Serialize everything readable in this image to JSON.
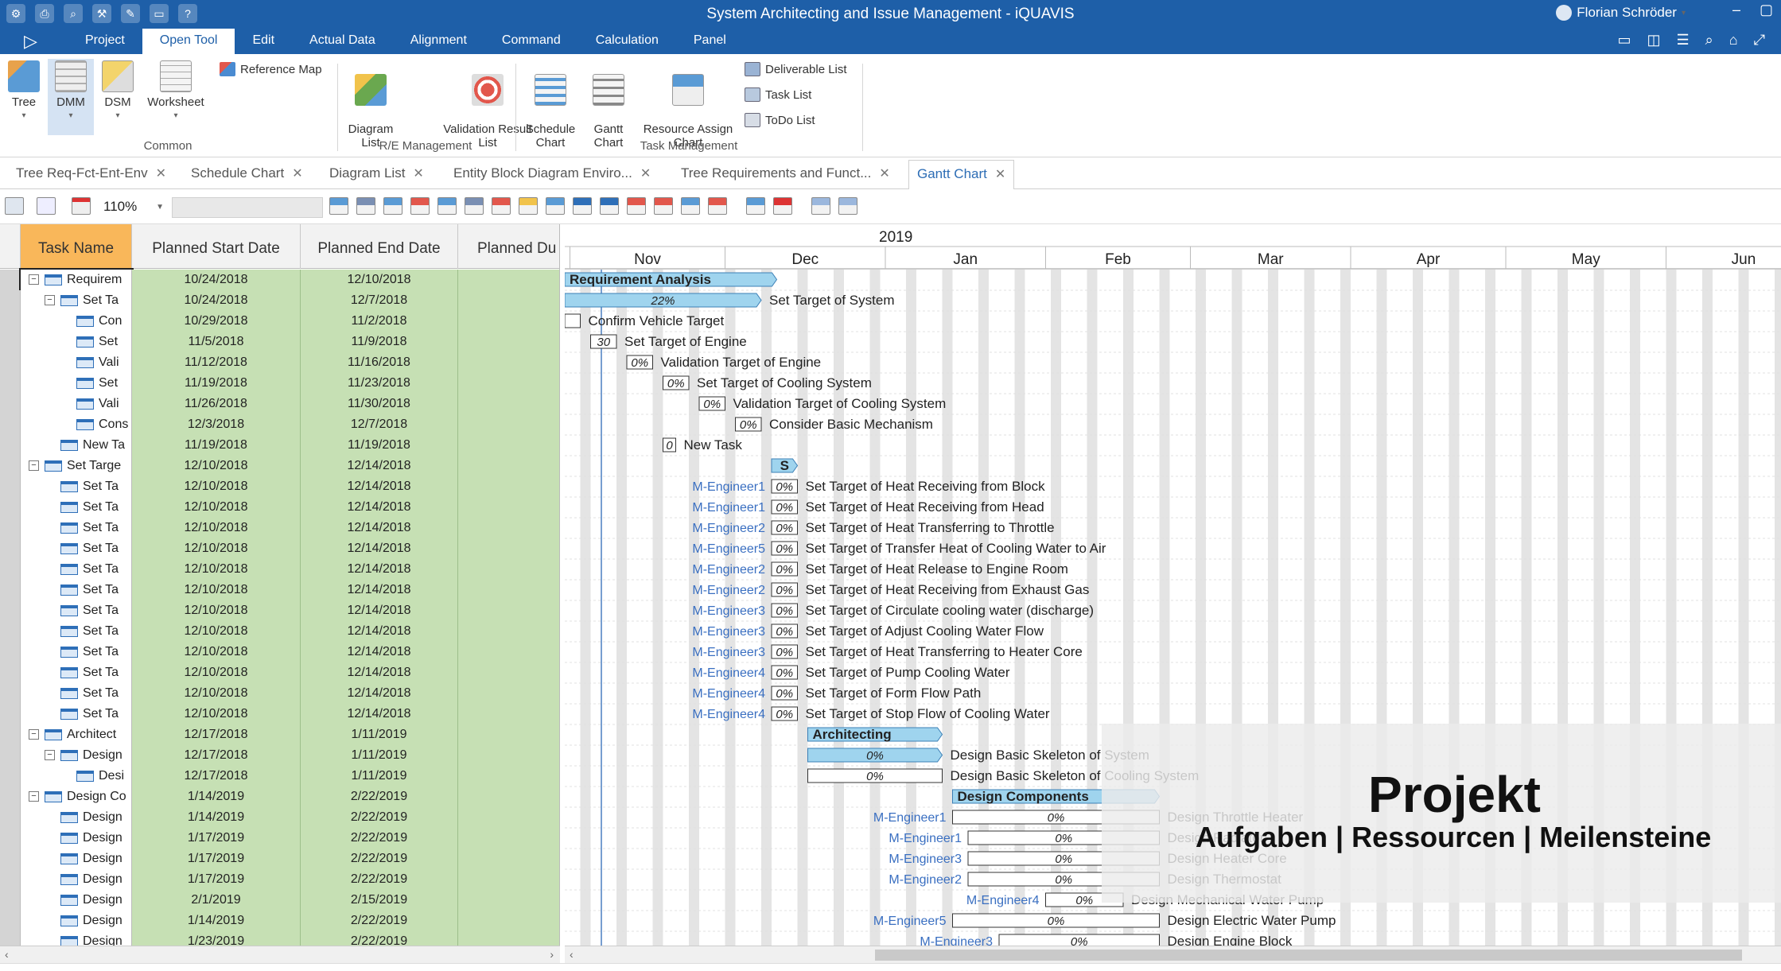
{
  "window": {
    "title": "System Architecting and Issue Management - iQUAVIS",
    "user": "Florian Schröder",
    "controls": [
      "–",
      "▢"
    ]
  },
  "menu": {
    "tabs": [
      "Project",
      "Open Tool",
      "Edit",
      "Actual Data",
      "Alignment",
      "Command",
      "Calculation",
      "Panel"
    ],
    "active": "Open Tool"
  },
  "ribbon": {
    "tree": "Tree",
    "dmm": "DMM",
    "dsm": "DSM",
    "worksheet": "Worksheet",
    "reference_map": "Reference Map",
    "diagram_list": "Diagram\nList",
    "validation_result_list": "Validation Result\nList",
    "schedule_chart": "Schedule\nChart",
    "gantt_chart": "Gantt\nChart",
    "resource_assign_chart": "Resource Assign\nChart",
    "deliverable_list": "Deliverable List",
    "task_list": "Task List",
    "todo_list": "ToDo List",
    "groups": {
      "common": "Common",
      "re_management": "R/E Management",
      "task_management": "Task Management"
    }
  },
  "doc_tabs": [
    {
      "label": "Tree Req-Fct-Ent-Env"
    },
    {
      "label": "Schedule Chart"
    },
    {
      "label": "Diagram List"
    },
    {
      "label": "Entity Block Diagram Enviro..."
    },
    {
      "label": "Tree Requirements and Funct..."
    },
    {
      "label": "Gantt Chart",
      "active": true
    }
  ],
  "toolbar": {
    "zoom": "110%"
  },
  "grid": {
    "columns": [
      "Task Name",
      "Planned Start Date",
      "Planned End Date",
      "Planned Du"
    ],
    "rows": [
      {
        "name": "Requirem",
        "start": "10/24/2018",
        "end": "12/10/2018",
        "level": 0,
        "toggle": "⊟"
      },
      {
        "name": "Set Ta",
        "start": "10/24/2018",
        "end": "12/7/2018",
        "level": 1,
        "toggle": "⊟"
      },
      {
        "name": "Con",
        "start": "10/29/2018",
        "end": "11/2/2018",
        "level": 2
      },
      {
        "name": "Set",
        "start": "11/5/2018",
        "end": "11/9/2018",
        "level": 2
      },
      {
        "name": "Vali",
        "start": "11/12/2018",
        "end": "11/16/2018",
        "level": 2
      },
      {
        "name": "Set",
        "start": "11/19/2018",
        "end": "11/23/2018",
        "level": 2
      },
      {
        "name": "Vali",
        "start": "11/26/2018",
        "end": "11/30/2018",
        "level": 2
      },
      {
        "name": "Cons",
        "start": "12/3/2018",
        "end": "12/7/2018",
        "level": 2
      },
      {
        "name": "New Ta",
        "start": "11/19/2018",
        "end": "11/19/2018",
        "level": 1
      },
      {
        "name": "Set Targe",
        "start": "12/10/2018",
        "end": "12/14/2018",
        "level": 0,
        "toggle": "⊟"
      },
      {
        "name": "Set Ta",
        "start": "12/10/2018",
        "end": "12/14/2018",
        "level": 1
      },
      {
        "name": "Set Ta",
        "start": "12/10/2018",
        "end": "12/14/2018",
        "level": 1
      },
      {
        "name": "Set Ta",
        "start": "12/10/2018",
        "end": "12/14/2018",
        "level": 1
      },
      {
        "name": "Set Ta",
        "start": "12/10/2018",
        "end": "12/14/2018",
        "level": 1
      },
      {
        "name": "Set Ta",
        "start": "12/10/2018",
        "end": "12/14/2018",
        "level": 1
      },
      {
        "name": "Set Ta",
        "start": "12/10/2018",
        "end": "12/14/2018",
        "level": 1
      },
      {
        "name": "Set Ta",
        "start": "12/10/2018",
        "end": "12/14/2018",
        "level": 1
      },
      {
        "name": "Set Ta",
        "start": "12/10/2018",
        "end": "12/14/2018",
        "level": 1
      },
      {
        "name": "Set Ta",
        "start": "12/10/2018",
        "end": "12/14/2018",
        "level": 1
      },
      {
        "name": "Set Ta",
        "start": "12/10/2018",
        "end": "12/14/2018",
        "level": 1
      },
      {
        "name": "Set Ta",
        "start": "12/10/2018",
        "end": "12/14/2018",
        "level": 1
      },
      {
        "name": "Set Ta",
        "start": "12/10/2018",
        "end": "12/14/2018",
        "level": 1
      },
      {
        "name": "Architect",
        "start": "12/17/2018",
        "end": "1/11/2019",
        "level": 0,
        "toggle": "⊟"
      },
      {
        "name": "Design",
        "start": "12/17/2018",
        "end": "1/11/2019",
        "level": 1,
        "toggle": "⊟"
      },
      {
        "name": "Desi",
        "start": "12/17/2018",
        "end": "1/11/2019",
        "level": 2
      },
      {
        "name": "Design Co",
        "start": "1/14/2019",
        "end": "2/22/2019",
        "level": 0,
        "toggle": "⊟"
      },
      {
        "name": "Design",
        "start": "1/14/2019",
        "end": "2/22/2019",
        "level": 1
      },
      {
        "name": "Design",
        "start": "1/17/2019",
        "end": "2/22/2019",
        "level": 1
      },
      {
        "name": "Design",
        "start": "1/17/2019",
        "end": "2/22/2019",
        "level": 1
      },
      {
        "name": "Design",
        "start": "1/17/2019",
        "end": "2/22/2019",
        "level": 1
      },
      {
        "name": "Design",
        "start": "2/1/2019",
        "end": "2/15/2019",
        "level": 1
      },
      {
        "name": "Design",
        "start": "1/14/2019",
        "end": "2/22/2019",
        "level": 1
      },
      {
        "name": "Design",
        "start": "1/23/2019",
        "end": "2/22/2019",
        "level": 1
      }
    ]
  },
  "gantt": {
    "year": "2019",
    "months": [
      "Nov",
      "Dec",
      "Jan",
      "Feb",
      "Mar",
      "Apr",
      "May",
      "Jun"
    ],
    "tasks": [
      {
        "label": "Requirement Analysis",
        "start": "10/24/2018",
        "end": "12/10/2018",
        "kind": "summary",
        "inside": true
      },
      {
        "label": "Set Target of System",
        "start": "10/24/2018",
        "end": "12/7/2018",
        "kind": "summary",
        "pct": "22%"
      },
      {
        "label": "Confirm Vehicle Target",
        "start": "10/29/2018",
        "end": "11/2/2018",
        "kind": "task",
        "pct": ""
      },
      {
        "label": "Set Target of Engine",
        "start": "11/5/2018",
        "end": "11/9/2018",
        "kind": "task",
        "pct": "30"
      },
      {
        "label": "Validation Target of Engine",
        "start": "11/12/2018",
        "end": "11/16/2018",
        "kind": "task",
        "pct": "0%"
      },
      {
        "label": "Set Target of Cooling System",
        "start": "11/19/2018",
        "end": "11/23/2018",
        "kind": "task",
        "pct": "0%"
      },
      {
        "label": "Validation Target of Cooling System",
        "start": "11/26/2018",
        "end": "11/30/2018",
        "kind": "task",
        "pct": "0%"
      },
      {
        "label": "Consider Basic Mechanism",
        "start": "12/3/2018",
        "end": "12/7/2018",
        "kind": "task",
        "pct": "0%"
      },
      {
        "label": "New Task",
        "start": "11/19/2018",
        "end": "11/19/2018",
        "kind": "task",
        "pct": "0"
      },
      {
        "label": "S",
        "start": "12/10/2018",
        "end": "12/14/2018",
        "kind": "summary",
        "inside": true
      },
      {
        "label": "Set Target of Heat Receiving from Block",
        "start": "12/10/2018",
        "end": "12/14/2018",
        "kind": "task",
        "pct": "0%",
        "res": "M-Engineer1"
      },
      {
        "label": "Set Target of Heat Receiving from Head",
        "start": "12/10/2018",
        "end": "12/14/2018",
        "kind": "task",
        "pct": "0%",
        "res": "M-Engineer1"
      },
      {
        "label": "Set Target of Heat Transferring to Throttle",
        "start": "12/10/2018",
        "end": "12/14/2018",
        "kind": "task",
        "pct": "0%",
        "res": "M-Engineer2"
      },
      {
        "label": "Set Target of Transfer Heat of Cooling Water to Air",
        "start": "12/10/2018",
        "end": "12/14/2018",
        "kind": "task",
        "pct": "0%",
        "res": "M-Engineer5"
      },
      {
        "label": "Set Target of Heat Release to Engine Room",
        "start": "12/10/2018",
        "end": "12/14/2018",
        "kind": "task",
        "pct": "0%",
        "res": "M-Engineer2"
      },
      {
        "label": "Set Target of Heat Receiving from Exhaust Gas",
        "start": "12/10/2018",
        "end": "12/14/2018",
        "kind": "task",
        "pct": "0%",
        "res": "M-Engineer2"
      },
      {
        "label": "Set Target of Circulate cooling water (discharge)",
        "start": "12/10/2018",
        "end": "12/14/2018",
        "kind": "task",
        "pct": "0%",
        "res": "M-Engineer3"
      },
      {
        "label": "Set Target of Adjust Cooling Water Flow",
        "start": "12/10/2018",
        "end": "12/14/2018",
        "kind": "task",
        "pct": "0%",
        "res": "M-Engineer3"
      },
      {
        "label": "Set Target of Heat Transferring to Heater Core",
        "start": "12/10/2018",
        "end": "12/14/2018",
        "kind": "task",
        "pct": "0%",
        "res": "M-Engineer3"
      },
      {
        "label": "Set Target of Pump Cooling Water",
        "start": "12/10/2018",
        "end": "12/14/2018",
        "kind": "task",
        "pct": "0%",
        "res": "M-Engineer4"
      },
      {
        "label": "Set Target of Form Flow Path",
        "start": "12/10/2018",
        "end": "12/14/2018",
        "kind": "task",
        "pct": "0%",
        "res": "M-Engineer4"
      },
      {
        "label": "Set Target of Stop Flow of Cooling Water",
        "start": "12/10/2018",
        "end": "12/14/2018",
        "kind": "task",
        "pct": "0%",
        "res": "M-Engineer4"
      },
      {
        "label": "Architecting",
        "start": "12/17/2018",
        "end": "1/11/2019",
        "kind": "summary",
        "inside": true
      },
      {
        "label": "Design Basic Skeleton of System",
        "start": "12/17/2018",
        "end": "1/11/2019",
        "kind": "summary",
        "pct": "0%"
      },
      {
        "label": "Design Basic Skeleton of Cooling System",
        "start": "12/17/2018",
        "end": "1/11/2019",
        "kind": "task",
        "pct": "0%"
      },
      {
        "label": "Design Components",
        "start": "1/14/2019",
        "end": "2/22/2019",
        "kind": "summary",
        "inside": true
      },
      {
        "label": "Design Throttle Heater",
        "start": "1/14/2019",
        "end": "2/22/2019",
        "kind": "task",
        "pct": "0%",
        "res": "M-Engineer1"
      },
      {
        "label": "Design Radiator",
        "start": "1/17/2019",
        "end": "2/22/2019",
        "kind": "task",
        "pct": "0%",
        "res": "M-Engineer1"
      },
      {
        "label": "Design Heater Core",
        "start": "1/17/2019",
        "end": "2/22/2019",
        "kind": "task",
        "pct": "0%",
        "res": "M-Engineer3"
      },
      {
        "label": "Design Thermostat",
        "start": "1/17/2019",
        "end": "2/22/2019",
        "kind": "task",
        "pct": "0%",
        "res": "M-Engineer2"
      },
      {
        "label": "Design Mechanical Water Pump",
        "start": "2/1/2019",
        "end": "2/15/2019",
        "kind": "task",
        "pct": "0%",
        "res": "M-Engineer4"
      },
      {
        "label": "Design Electric Water Pump",
        "start": "1/14/2019",
        "end": "2/22/2019",
        "kind": "task",
        "pct": "0%",
        "res": "M-Engineer5"
      },
      {
        "label": "Design Engine Block",
        "start": "1/23/2019",
        "end": "2/22/2019",
        "kind": "task",
        "pct": "0%",
        "res": "M-Engineer3"
      }
    ]
  },
  "overlay": {
    "title": "Projekt",
    "subtitle": "Aufgaben | Ressourcen | Meilensteine"
  },
  "colors": {
    "title_bar": "#1e5fa8",
    "summary_bar": "#9fd4ee",
    "task_bar": "#ffffff",
    "date_cell": "#c6e0b4",
    "header_active": "#f9b75a",
    "resource_text": "#3a6fc1"
  }
}
